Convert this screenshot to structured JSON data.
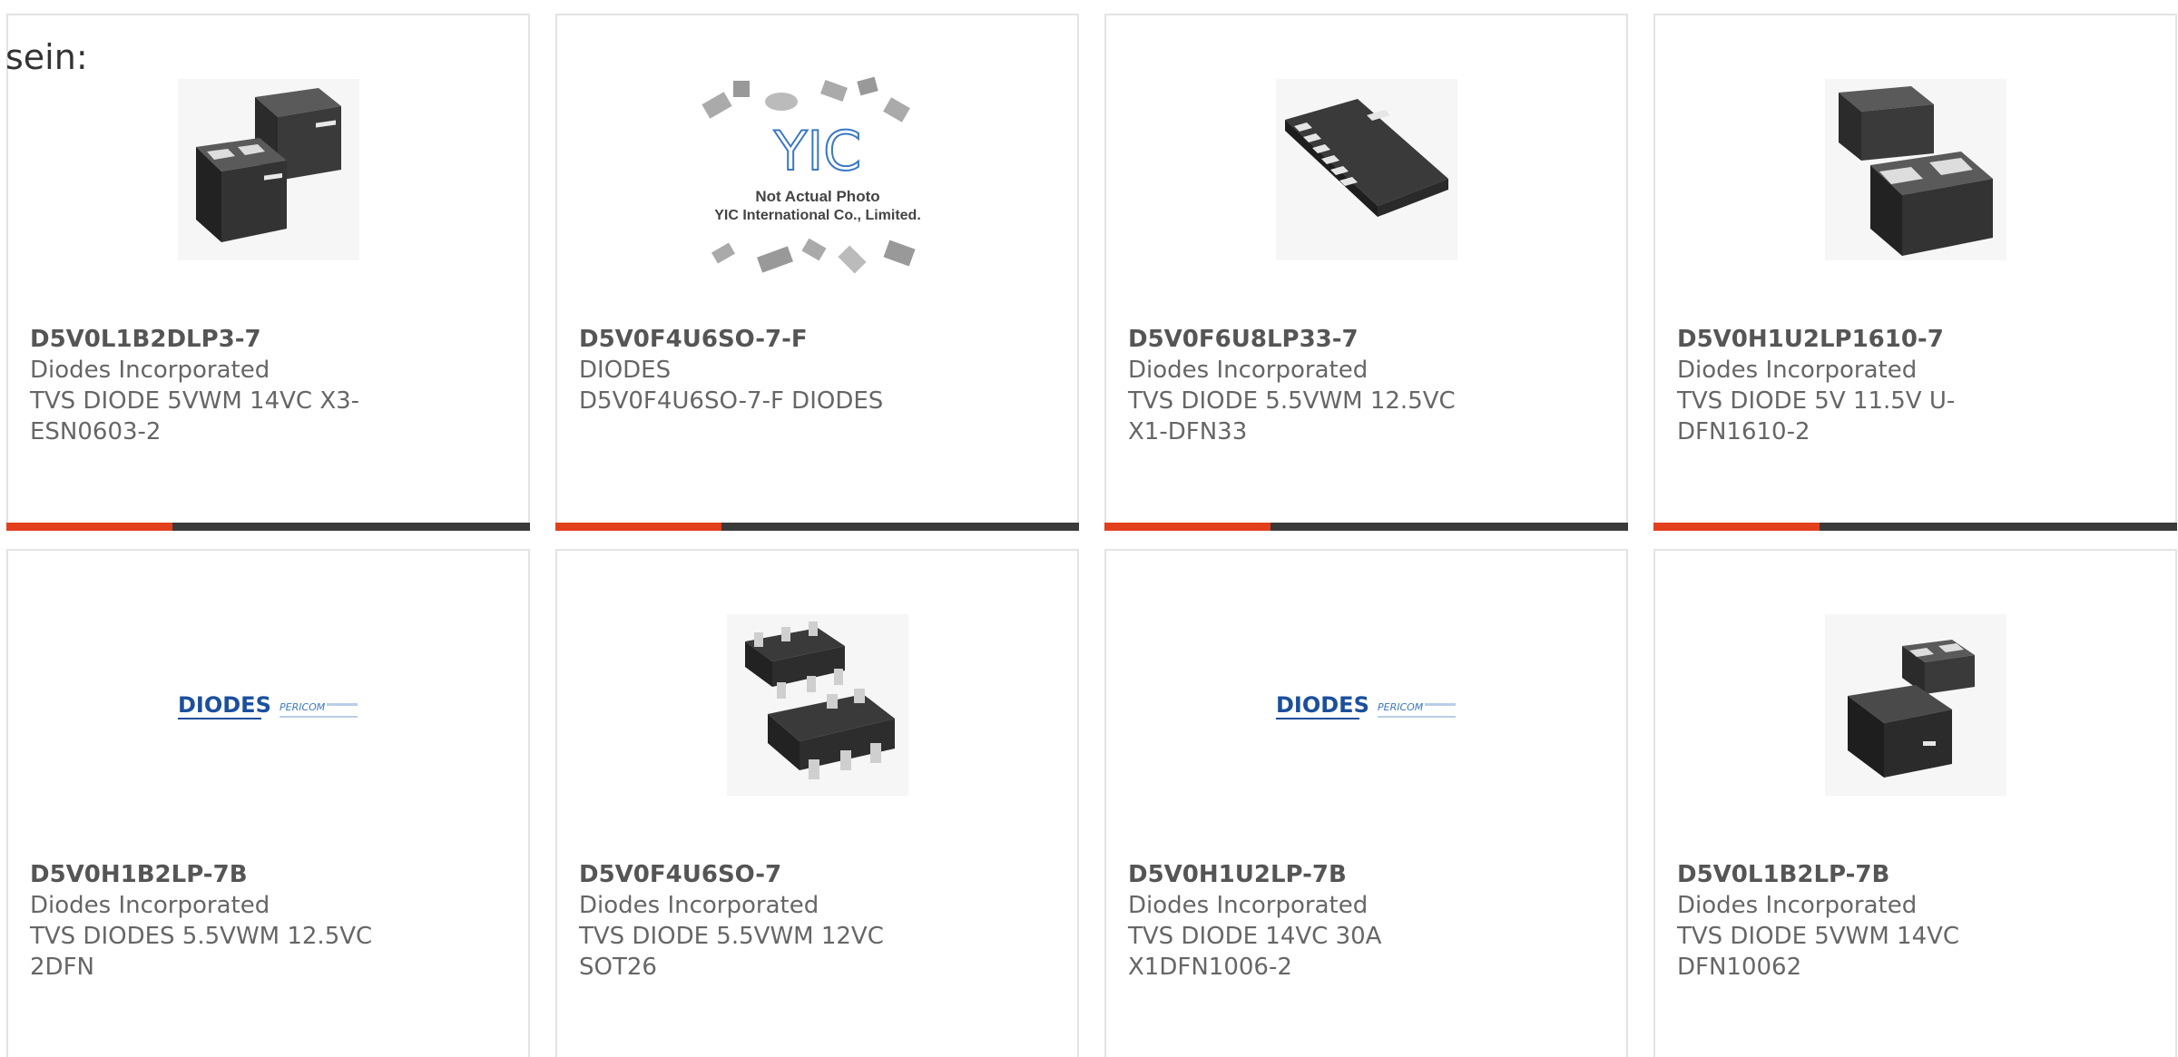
{
  "intro_text": "sein:",
  "colors": {
    "accent": "#e2401c",
    "bar": "#3a3a3a",
    "border": "#e3e3e3"
  },
  "products": [
    {
      "part_number": "D5V0L1B2DLP3-7",
      "manufacturer": "Diodes Incorporated",
      "description": "TVS DIODE 5VWM 14VC X3-ESN0603-2",
      "image": "dual-package-icon"
    },
    {
      "part_number": "D5V0F4U6SO-7-F",
      "manufacturer": "DIODES",
      "description": "D5V0F4U6SO-7-F DIODES",
      "image": "yic-placeholder",
      "image_text": {
        "logo": "YIC",
        "line1": "Not Actual Photo",
        "line2": "YIC International Co., Limited."
      }
    },
    {
      "part_number": "D5V0F6U8LP33-7",
      "manufacturer": "Diodes Incorporated",
      "description": "TVS DIODE 5.5VWM 12.5VC X1-DFN33",
      "image": "dfn-package-icon"
    },
    {
      "part_number": "D5V0H1U2LP1610-7",
      "manufacturer": "Diodes Incorporated",
      "description": "TVS DIODE 5V 11.5V U-DFN1610-2",
      "image": "dual-package-icon"
    },
    {
      "part_number": "D5V0H1B2LP-7B",
      "manufacturer": "Diodes Incorporated",
      "description": "TVS DIODES 5.5VWM 12.5VC 2DFN",
      "image": "diodes-logo",
      "image_text": {
        "logo": "DIODES",
        "sub": "PERICOM"
      }
    },
    {
      "part_number": "D5V0F4U6SO-7",
      "manufacturer": "Diodes Incorporated",
      "description": "TVS DIODE 5.5VWM 12VC SOT26",
      "image": "sot26-package-icon"
    },
    {
      "part_number": "D5V0H1U2LP-7B",
      "manufacturer": "Diodes Incorporated",
      "description": "TVS DIODE 14VC 30A X1DFN1006-2",
      "image": "diodes-logo",
      "image_text": {
        "logo": "DIODES",
        "sub": "PERICOM"
      }
    },
    {
      "part_number": "D5V0L1B2LP-7B",
      "manufacturer": "Diodes Incorporated",
      "description": "TVS DIODE 5VWM 14VC DFN10062",
      "image": "dual-package-icon"
    }
  ]
}
